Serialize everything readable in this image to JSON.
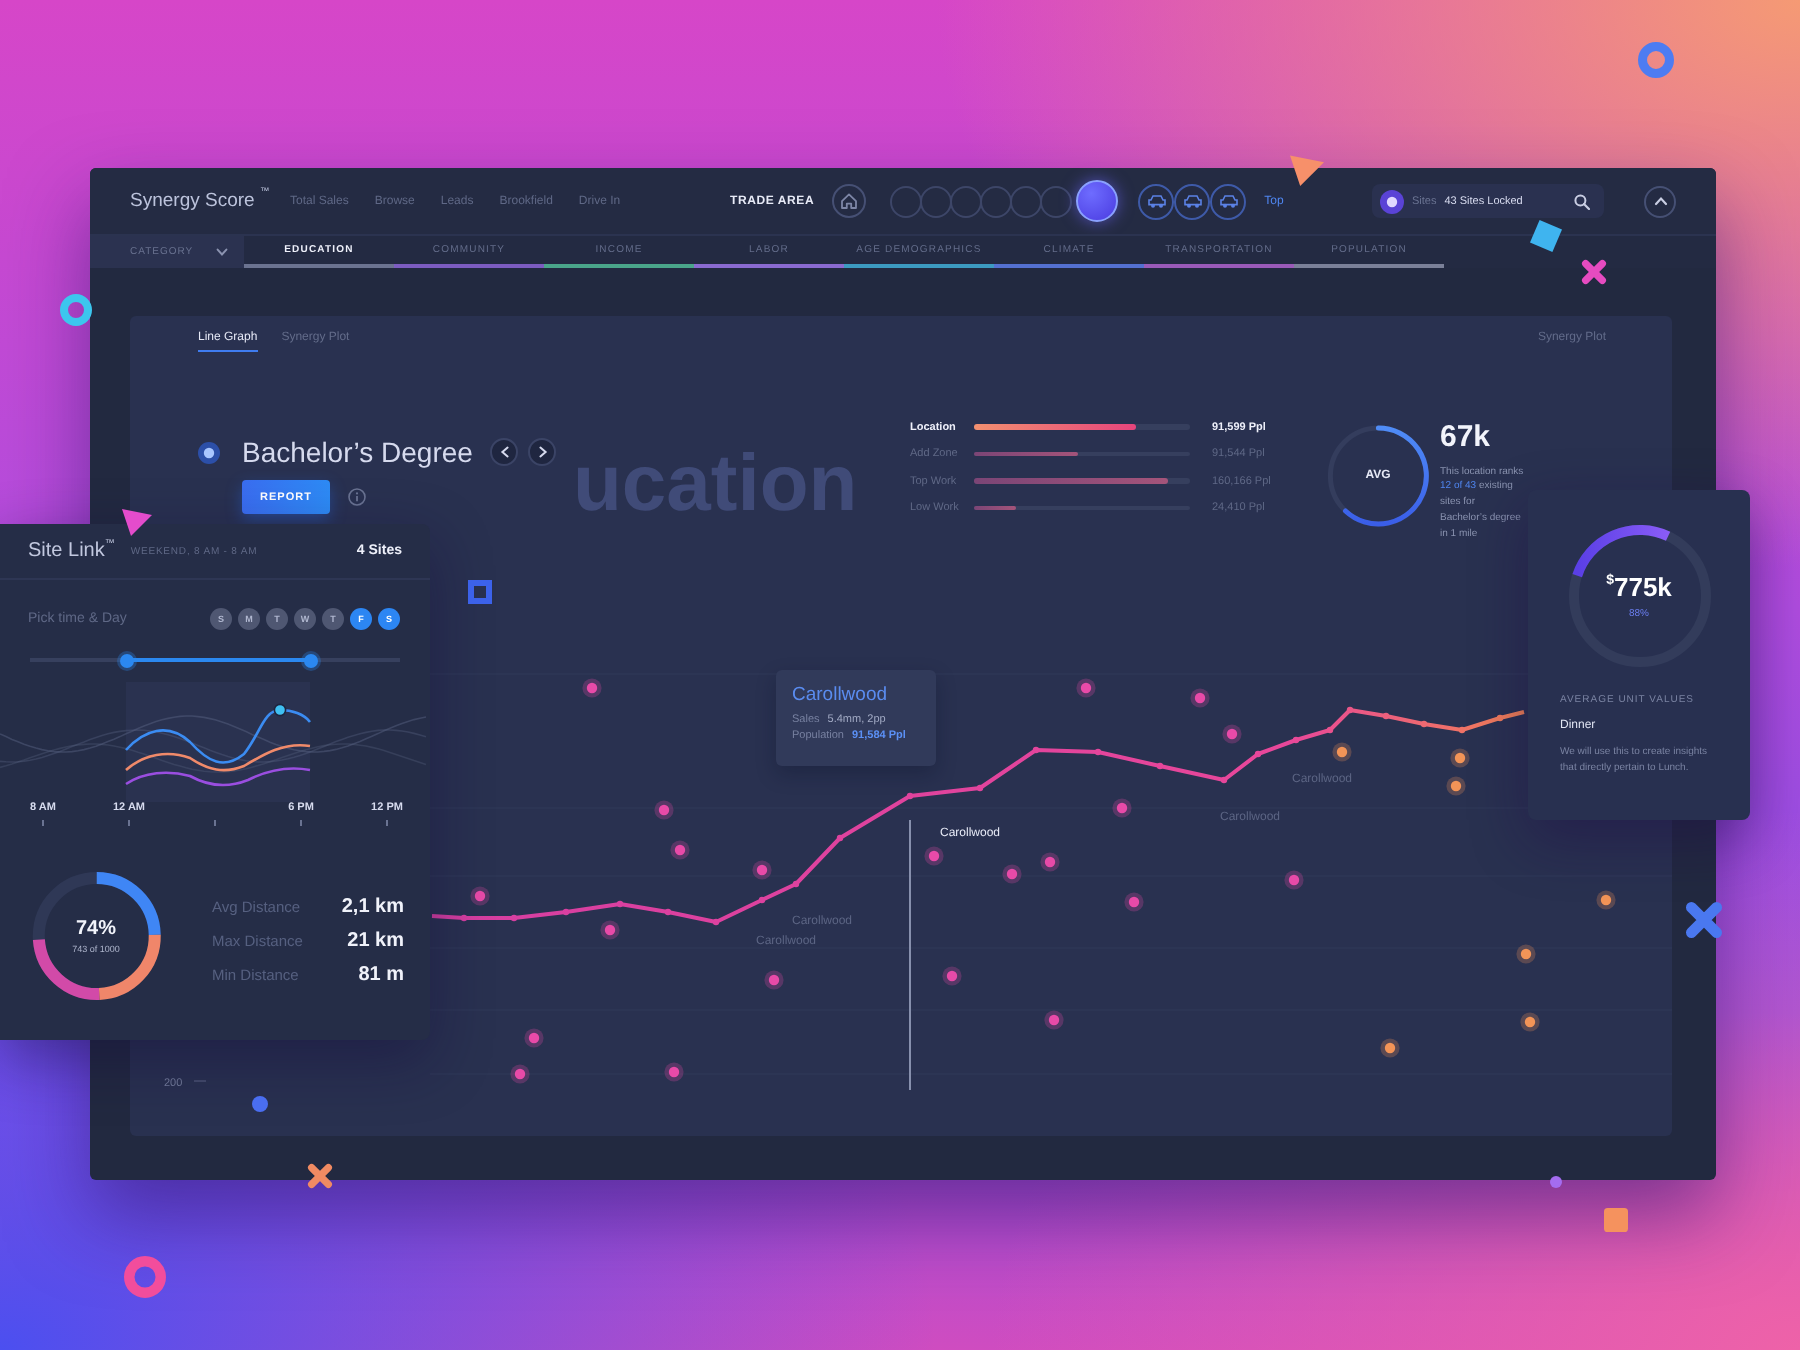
{
  "window": {
    "title": "Synergy Score $^{™}$"
  },
  "nav": [
    "Total Sales",
    "Browse",
    "Leads",
    "Brookfield",
    "Drive In"
  ],
  "trade_area": {
    "label": "TRADE AREA",
    "steps": [
      {
        "selected": false
      },
      {
        "selected": false
      },
      {
        "selected": false
      },
      {
        "selected": false
      },
      {
        "selected": false
      },
      {
        "selected": false
      },
      {
        "selected": true
      }
    ],
    "top_link": "Top"
  },
  "search": {
    "label": "Sites",
    "value": "43 Sites Locked"
  },
  "category": {
    "label": "CATEGORY"
  },
  "category_tabs": [
    {
      "label": "EDUCATION",
      "selected": true,
      "color": "#6b7390"
    },
    {
      "label": "COMMUNITY",
      "selected": false,
      "color": "#7c5cc0"
    },
    {
      "label": "INCOME",
      "selected": false,
      "color": "#4aa58a"
    },
    {
      "label": "LABOR",
      "selected": false,
      "color": "#8a6ad0"
    },
    {
      "label": "AGE DEMOGRAPHICS",
      "selected": false,
      "color": "#3c9ac0"
    },
    {
      "label": "CLIMATE",
      "selected": false,
      "color": "#5470d0"
    },
    {
      "label": "TRANSPORTATION",
      "selected": false,
      "color": "#9a5ab8"
    },
    {
      "label": "POPULATION",
      "selected": false,
      "color": "#7a8098"
    }
  ],
  "view_tabs": [
    {
      "label": "Line Graph",
      "selected": true
    },
    {
      "label": "Synergy Plot",
      "selected": false
    }
  ],
  "view_corner": "Synergy Plot",
  "heading": {
    "title": "Bachelor’s Degree",
    "button": "REPORT",
    "watermark": "ucation"
  },
  "metrics": [
    {
      "label": "Location",
      "value": "91,599 Ppl",
      "level": 0.75,
      "highlighted": true
    },
    {
      "label": "Add Zone",
      "value": "91,544 Ppl",
      "level": 0.48,
      "highlighted": false
    },
    {
      "label": "Top Work",
      "value": "160,166 Ppl",
      "level": 0.9,
      "highlighted": false
    },
    {
      "label": "Low Work",
      "value": "24,410 Ppl",
      "level": 0.19,
      "highlighted": false
    }
  ],
  "average": {
    "badge": "AVG",
    "level": 0.62,
    "value": "67k",
    "text": "This location ranks",
    "link": "12 of 43",
    "text_after": "existing sites for Bachelor’s degree in 1 mile"
  },
  "chart": {
    "tooltip": {
      "title": "Carollwood",
      "rows": [
        {
          "label": "Sales",
          "value": "5.4mm, 2pp"
        },
        {
          "label": "Population",
          "value": "91,584 Ppl"
        }
      ]
    },
    "point_labels": [
      {
        "text": "Carollwood",
        "active": false
      },
      {
        "text": "Carollwood",
        "active": false
      },
      {
        "text": "Carollwood",
        "active": true
      },
      {
        "text": "Carollwood",
        "active": false
      },
      {
        "text": "Carollwood",
        "active": false
      }
    ],
    "axis_label": "200"
  },
  "site_link": {
    "title": "Site Link$^{™}$",
    "schedule": "WEEKEND, 8 AM - 8 AM",
    "count": "4 Sites",
    "pick_label": "Pick time & Day",
    "days": [
      {
        "label": "S",
        "selected": false
      },
      {
        "label": "M",
        "selected": false
      },
      {
        "label": "T",
        "selected": false
      },
      {
        "label": "W",
        "selected": false
      },
      {
        "label": "T",
        "selected": false
      },
      {
        "label": "F",
        "selected": true
      },
      {
        "label": "S",
        "selected": true
      }
    ],
    "time_range": [
      {
        "level": 0.26
      },
      {
        "level": 0.76
      }
    ],
    "times": [
      "8 AM",
      "12 AM",
      "6 PM",
      "12 PM"
    ],
    "donut": {
      "value": "74%",
      "caption": "743 of 1000",
      "level": 0.74
    },
    "stats": [
      {
        "label": "Avg Distance",
        "value": "2,1 km"
      },
      {
        "label": "Max Distance",
        "value": "21 km"
      },
      {
        "label": "Min Distance",
        "value": "81 m"
      }
    ]
  },
  "unit_value": {
    "currency": "$",
    "value": "775k",
    "percent": "88%",
    "heading": "AVERAGE UNIT VALUES",
    "subheading": "Dinner",
    "text": "We will use this to create insights that directly pertain to Lunch."
  }
}
